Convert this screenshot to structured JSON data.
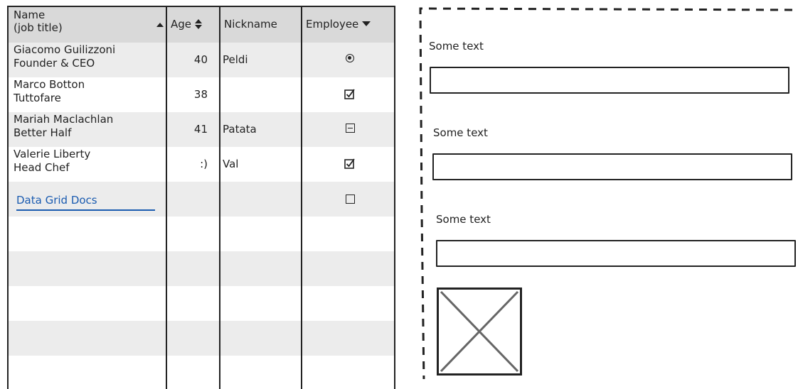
{
  "grid": {
    "columns": [
      {
        "label_line1": "Name",
        "label_line2": "(job title)",
        "sort": "ascending"
      },
      {
        "label": "Age",
        "sort": "both"
      },
      {
        "label": "Nickname"
      },
      {
        "label": "Employee",
        "sort": "dropdown"
      }
    ],
    "rows": [
      {
        "name": "Giacomo Guilizzoni",
        "title": "Founder & CEO",
        "age": "40",
        "nickname": "Peldi",
        "employee": "radio-selected"
      },
      {
        "name": "Marco Botton",
        "title": "Tuttofare",
        "age": "38",
        "nickname": "",
        "employee": "checked"
      },
      {
        "name": "Mariah Maclachlan",
        "title": "Better Half",
        "age": "41",
        "nickname": "Patata",
        "employee": "indeterminate"
      },
      {
        "name": "Valerie Liberty",
        "title": "Head Chef",
        "age": ":)",
        "nickname": "Val",
        "employee": "checked"
      }
    ],
    "link_row": {
      "label": "Data Grid Docs",
      "employee": "unchecked"
    }
  },
  "form": {
    "fields": [
      {
        "label": "Some text",
        "value": ""
      },
      {
        "label": "Some text",
        "value": ""
      },
      {
        "label": "Some text",
        "value": ""
      }
    ],
    "image_placeholder": "image-placeholder"
  },
  "colors": {
    "header_bg": "#d9d9d9",
    "alt_row_bg": "#ececec",
    "link": "#1a5bb0",
    "stroke": "#222222"
  }
}
